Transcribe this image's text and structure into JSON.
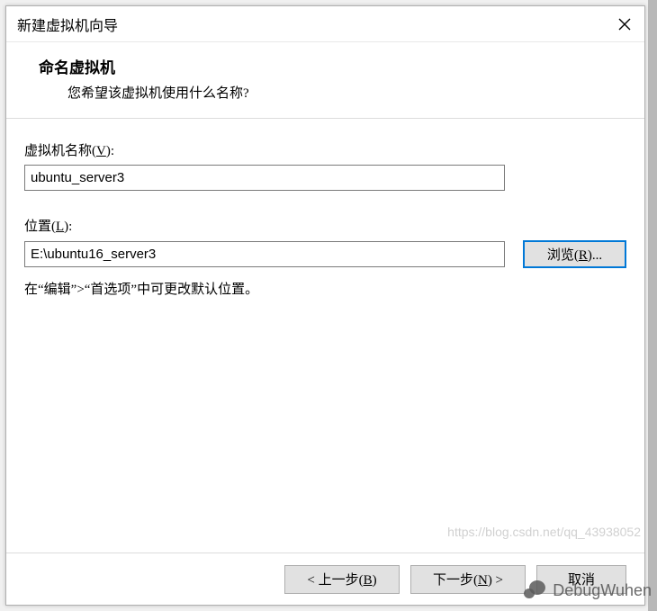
{
  "window": {
    "title": "新建虚拟机向导"
  },
  "header": {
    "title": "命名虚拟机",
    "subtitle": "您希望该虚拟机使用什么名称?"
  },
  "name": {
    "label_prefix": "虚拟机名称(",
    "label_key": "V",
    "label_suffix": "):",
    "value": "ubuntu_server3"
  },
  "location": {
    "label_prefix": "位置(",
    "label_key": "L",
    "label_suffix": "):",
    "value": "E:\\ubuntu16_server3",
    "browse_prefix": "浏览(",
    "browse_key": "R",
    "browse_suffix": ")..."
  },
  "hint": "在“编辑”>“首选项”中可更改默认位置。",
  "footer": {
    "back_prefix": "< 上一步(",
    "back_key": "B",
    "back_suffix": ")",
    "next_prefix": "下一步(",
    "next_key": "N",
    "next_suffix": ") >",
    "cancel": "取消"
  },
  "watermark": {
    "url": "https://blog.csdn.net/qq_43938052",
    "brand": "DebugWuhen"
  }
}
